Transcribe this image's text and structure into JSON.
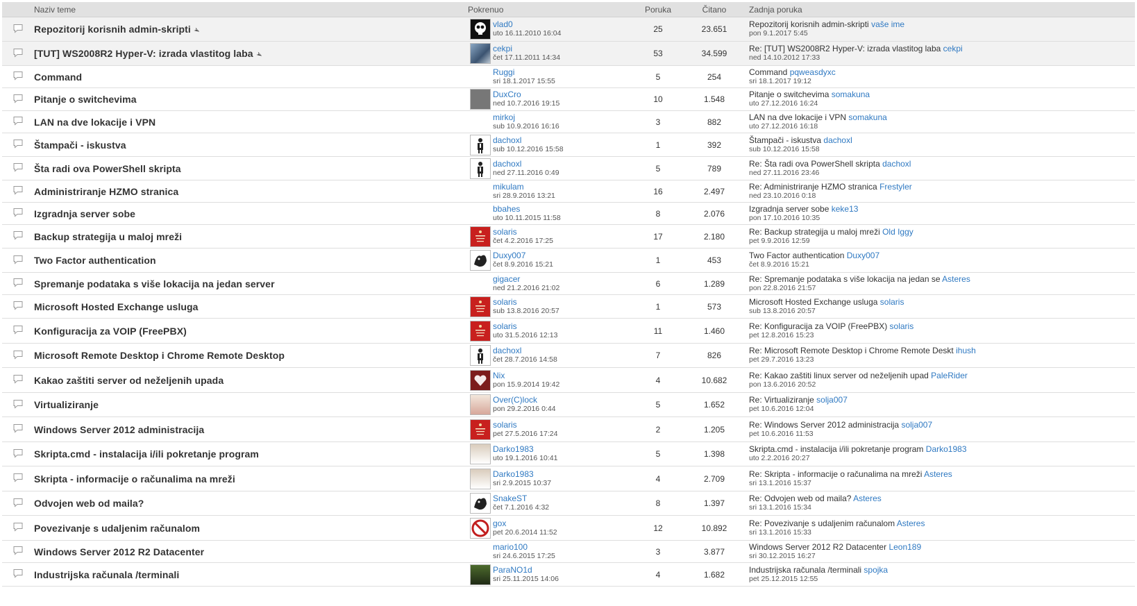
{
  "headers": {
    "topic": "Naziv teme",
    "starter": "Pokrenuo",
    "replies": "Poruka",
    "views": "Čitano",
    "last": "Zadnja poruka"
  },
  "topics": [
    {
      "title": "Repozitorij korisnih admin-skripti",
      "sticky": true,
      "avatar": "skull",
      "starter": "vlad0",
      "start_date": "uto 16.11.2010 16:04",
      "replies": "25",
      "views": "23.651",
      "last_subject": "Repozitorij korisnih admin-skripti",
      "last_user": "vaše ime",
      "last_date": "pon 9.1.2017 5:45",
      "height": 35
    },
    {
      "title": "[TUT] WS2008R2 Hyper-V: izrada vlastitog laba",
      "sticky": true,
      "avatar": "photo",
      "starter": "cekpi",
      "start_date": "čet 17.11.2011 14:34",
      "replies": "53",
      "views": "34.599",
      "last_subject": "Re: [TUT] WS2008R2 Hyper-V: izrada vlastitog laba",
      "last_user": "cekpi",
      "last_date": "ned 14.10.2012 17:33",
      "height": 35
    },
    {
      "title": "Command",
      "sticky": false,
      "avatar": "",
      "starter": "Ruggi",
      "start_date": "sri 18.1.2017 15:55",
      "replies": "5",
      "views": "254",
      "last_subject": "Command",
      "last_user": "pqweasdyxc",
      "last_date": "sri 18.1.2017 19:12",
      "height": 32
    },
    {
      "title": "Pitanje o switchevima",
      "sticky": false,
      "avatar": "cat2",
      "starter": "DuxCro",
      "start_date": "ned 10.7.2016 19:15",
      "replies": "10",
      "views": "1.548",
      "last_subject": "Pitanje o switchevima",
      "last_user": "somakuna",
      "last_date": "uto 27.12.2016 16:24",
      "height": 33
    },
    {
      "title": "LAN na dve lokacije i VPN",
      "sticky": false,
      "avatar": "",
      "starter": "mirkoj",
      "start_date": "sub 10.9.2016 16:16",
      "replies": "3",
      "views": "882",
      "last_subject": "LAN na dve lokacije i VPN",
      "last_user": "somakuna",
      "last_date": "uto 27.12.2016 16:18",
      "height": 32
    },
    {
      "title": "Štampači - iskustva",
      "sticky": false,
      "avatar": "fig",
      "starter": "dachoxl",
      "start_date": "sub 10.12.2016 15:58",
      "replies": "1",
      "views": "392",
      "last_subject": "Štampači - iskustva",
      "last_user": "dachoxl",
      "last_date": "sub 10.12.2016 15:58",
      "height": 34
    },
    {
      "title": "Šta radi ova PowerShell skripta",
      "sticky": false,
      "avatar": "fig",
      "starter": "dachoxl",
      "start_date": "ned 27.11.2016 0:49",
      "replies": "5",
      "views": "789",
      "last_subject": "Re: Šta radi ova PowerShell skripta",
      "last_user": "dachoxl",
      "last_date": "ned 27.11.2016 23:46",
      "height": 34
    },
    {
      "title": "Administriranje HZMO stranica",
      "sticky": false,
      "avatar": "",
      "starter": "mikulam",
      "start_date": "sri 28.9.2016 13:21",
      "replies": "16",
      "views": "2.497",
      "last_subject": "Re: Administriranje HZMO stranica",
      "last_user": "Frestyler",
      "last_date": "ned 23.10.2016 0:18",
      "height": 32
    },
    {
      "title": "Izgradnja server sobe",
      "sticky": false,
      "avatar": "",
      "starter": "bbahes",
      "start_date": "uto 10.11.2015 11:58",
      "replies": "8",
      "views": "2.076",
      "last_subject": "Izgradnja server sobe",
      "last_user": "keke13",
      "last_date": "pon 17.10.2016 10:35",
      "height": 32
    },
    {
      "title": "Backup strategija u maloj mreži",
      "sticky": false,
      "avatar": "red",
      "starter": "solaris",
      "start_date": "čet 4.2.2016 17:25",
      "replies": "17",
      "views": "2.180",
      "last_subject": "Re: Backup strategija u maloj mreži",
      "last_user": "Old Iggy",
      "last_date": "pet 9.9.2016 12:59",
      "height": 34
    },
    {
      "title": "Two Factor authentication",
      "sticky": false,
      "avatar": "dark",
      "starter": "Duxy007",
      "start_date": "čet 8.9.2016 15:21",
      "replies": "1",
      "views": "453",
      "last_subject": "Two Factor authentication",
      "last_user": "Duxy007",
      "last_date": "čet 8.9.2016 15:21",
      "height": 35
    },
    {
      "title": "Spremanje podataka s više lokacija na jedan server",
      "sticky": false,
      "avatar": "",
      "starter": "gigacer",
      "start_date": "ned 21.2.2016 21:02",
      "replies": "6",
      "views": "1.289",
      "last_subject": "Re: Spremanje podataka s više lokacija na jedan se",
      "last_user": "Asteres",
      "last_date": "pon 22.8.2016 21:57",
      "height": 32
    },
    {
      "title": "Microsoft Hosted Exchange usluga",
      "sticky": false,
      "avatar": "red",
      "starter": "solaris",
      "start_date": "sub 13.8.2016 20:57",
      "replies": "1",
      "views": "573",
      "last_subject": "Microsoft Hosted Exchange usluga",
      "last_user": "solaris",
      "last_date": "sub 13.8.2016 20:57",
      "height": 34
    },
    {
      "title": "Konfiguracija za VOIP (FreePBX)",
      "sticky": false,
      "avatar": "red",
      "starter": "solaris",
      "start_date": "uto 31.5.2016 12:13",
      "replies": "11",
      "views": "1.460",
      "last_subject": "Re: Konfiguracija za VOIP (FreePBX)",
      "last_user": "solaris",
      "last_date": "pet 12.8.2016 15:23",
      "height": 36
    },
    {
      "title": "Microsoft Remote Desktop i Chrome Remote Desktop",
      "sticky": false,
      "avatar": "fig",
      "starter": "dachoxl",
      "start_date": "čet 28.7.2016 14:58",
      "replies": "7",
      "views": "826",
      "last_subject": "Re: Microsoft Remote Desktop i Chrome Remote Deskt",
      "last_user": "ihush",
      "last_date": "pet 29.7.2016 13:23",
      "height": 35
    },
    {
      "title": "Kakao zaštiti server od neželjenih upada",
      "sticky": false,
      "avatar": "heart",
      "starter": "Nix",
      "start_date": "pon 15.9.2014 19:42",
      "replies": "4",
      "views": "10.682",
      "last_subject": "Re: Kakao zaštiti linux server od neželjenih upad",
      "last_user": "PaleRider",
      "last_date": "pon 13.6.2016 20:52",
      "height": 36
    },
    {
      "title": "Virtualiziranje",
      "sticky": false,
      "avatar": "santa",
      "starter": "Over(C)lock",
      "start_date": "pon 29.2.2016 0:44",
      "replies": "5",
      "views": "1.652",
      "last_subject": "Re: Virtualiziranje",
      "last_user": "solja007",
      "last_date": "pet 10.6.2016 12:04",
      "height": 35
    },
    {
      "title": "Windows Server 2012 administracija",
      "sticky": false,
      "avatar": "red",
      "starter": "solaris",
      "start_date": "pet 27.5.2016 17:24",
      "replies": "2",
      "views": "1.205",
      "last_subject": "Re: Windows Server 2012 administracija",
      "last_user": "solja007",
      "last_date": "pet 10.6.2016 11:53",
      "height": 36
    },
    {
      "title": "Skripta.cmd - instalacija i/ili pokretanje program",
      "sticky": false,
      "avatar": "bowtie",
      "starter": "Darko1983",
      "start_date": "uto 19.1.2016 10:41",
      "replies": "5",
      "views": "1.398",
      "last_subject": "Skripta.cmd - instalacija i/ili pokretanje program",
      "last_user": "Darko1983",
      "last_date": "uto 2.2.2016 20:27",
      "height": 35
    },
    {
      "title": "Skripta - informacije o računalima na mreži",
      "sticky": false,
      "avatar": "bowtie",
      "starter": "Darko1983",
      "start_date": "sri 2.9.2015 10:37",
      "replies": "4",
      "views": "2.709",
      "last_subject": "Re: Skripta - informacije o računalima na mreži",
      "last_user": "Asteres",
      "last_date": "sri 13.1.2016 15:37",
      "height": 36
    },
    {
      "title": "Odvojen web od maila?",
      "sticky": false,
      "avatar": "dark",
      "starter": "SnakeST",
      "start_date": "čet 7.1.2016 4:32",
      "replies": "8",
      "views": "1.397",
      "last_subject": "Re: Odvojen web od maila?",
      "last_user": "Asteres",
      "last_date": "sri 13.1.2016 15:34",
      "height": 35
    },
    {
      "title": "Povezivanje s udaljenim računalom",
      "sticky": false,
      "avatar": "sign",
      "starter": "gox",
      "start_date": "pet 20.6.2014 11:52",
      "replies": "12",
      "views": "10.892",
      "last_subject": "Re: Povezivanje s udaljenim računalom",
      "last_user": "Asteres",
      "last_date": "sri 13.1.2016 15:33",
      "height": 36
    },
    {
      "title": "Windows Server 2012 R2 Datacenter",
      "sticky": false,
      "avatar": "",
      "starter": "mario100",
      "start_date": "sri 24.6.2015 17:25",
      "replies": "3",
      "views": "3.877",
      "last_subject": "Windows Server 2012 R2 Datacenter",
      "last_user": "Leon189",
      "last_date": "sri 30.12.2015 16:27",
      "height": 32
    },
    {
      "title": "Industrijska računala /terminali",
      "sticky": false,
      "avatar": "cat",
      "starter": "ParaNO1d",
      "start_date": "sri 25.11.2015 14:06",
      "replies": "4",
      "views": "1.682",
      "last_subject": "Industrijska računala /terminali",
      "last_user": "spojka",
      "last_date": "pet 25.12.2015 12:55",
      "height": 34
    }
  ]
}
